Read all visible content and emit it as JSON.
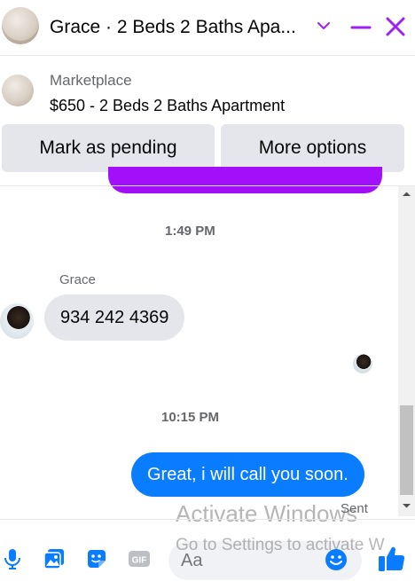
{
  "header": {
    "title": "Grace · 2 Beds 2 Baths Apa...",
    "icons": {
      "dropdown": "chevron-down-icon",
      "minimize": "minimize-icon",
      "close": "close-icon"
    }
  },
  "listing": {
    "label": "Marketplace",
    "title": "$650 - 2 Beds 2 Baths Apartment",
    "mark_pending_label": "Mark as pending",
    "more_options_label": "More options"
  },
  "messages": {
    "time_1": "1:49 PM",
    "sender_name": "Grace",
    "incoming_text": "934 242 4369",
    "time_2": "10:15 PM",
    "outgoing_text": "Great, i will call you soon.",
    "status": "Sent"
  },
  "composer": {
    "placeholder": "Aa",
    "icons": [
      "microphone-icon",
      "gallery-icon",
      "sticker-icon",
      "gif-icon",
      "emoji-icon",
      "thumbs-up-icon"
    ]
  },
  "watermark": {
    "title": "Activate Windows",
    "subtitle": "Go to Settings to activate W"
  },
  "colors": {
    "accent": "#a020f0",
    "outgoing_bubble": "#0a7cff",
    "incoming_bubble": "#e4e6eb",
    "button_bg": "#e4e6eb",
    "icon_blue": "#0a7cff"
  }
}
